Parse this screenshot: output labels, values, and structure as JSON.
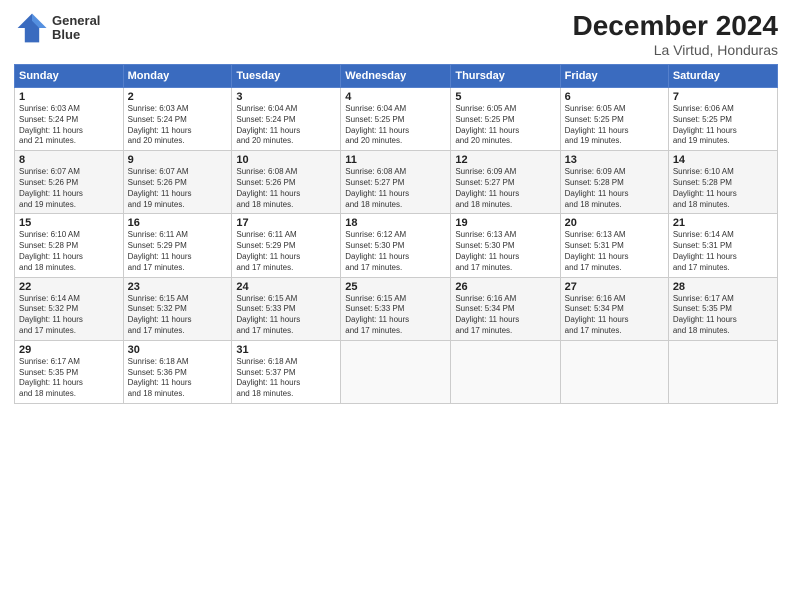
{
  "header": {
    "logo_line1": "General",
    "logo_line2": "Blue",
    "title": "December 2024",
    "subtitle": "La Virtud, Honduras"
  },
  "weekdays": [
    "Sunday",
    "Monday",
    "Tuesday",
    "Wednesday",
    "Thursday",
    "Friday",
    "Saturday"
  ],
  "weeks": [
    [
      {
        "day": "1",
        "info": "Sunrise: 6:03 AM\nSunset: 5:24 PM\nDaylight: 11 hours\nand 21 minutes."
      },
      {
        "day": "2",
        "info": "Sunrise: 6:03 AM\nSunset: 5:24 PM\nDaylight: 11 hours\nand 20 minutes."
      },
      {
        "day": "3",
        "info": "Sunrise: 6:04 AM\nSunset: 5:24 PM\nDaylight: 11 hours\nand 20 minutes."
      },
      {
        "day": "4",
        "info": "Sunrise: 6:04 AM\nSunset: 5:25 PM\nDaylight: 11 hours\nand 20 minutes."
      },
      {
        "day": "5",
        "info": "Sunrise: 6:05 AM\nSunset: 5:25 PM\nDaylight: 11 hours\nand 20 minutes."
      },
      {
        "day": "6",
        "info": "Sunrise: 6:05 AM\nSunset: 5:25 PM\nDaylight: 11 hours\nand 19 minutes."
      },
      {
        "day": "7",
        "info": "Sunrise: 6:06 AM\nSunset: 5:25 PM\nDaylight: 11 hours\nand 19 minutes."
      }
    ],
    [
      {
        "day": "8",
        "info": "Sunrise: 6:07 AM\nSunset: 5:26 PM\nDaylight: 11 hours\nand 19 minutes."
      },
      {
        "day": "9",
        "info": "Sunrise: 6:07 AM\nSunset: 5:26 PM\nDaylight: 11 hours\nand 19 minutes."
      },
      {
        "day": "10",
        "info": "Sunrise: 6:08 AM\nSunset: 5:26 PM\nDaylight: 11 hours\nand 18 minutes."
      },
      {
        "day": "11",
        "info": "Sunrise: 6:08 AM\nSunset: 5:27 PM\nDaylight: 11 hours\nand 18 minutes."
      },
      {
        "day": "12",
        "info": "Sunrise: 6:09 AM\nSunset: 5:27 PM\nDaylight: 11 hours\nand 18 minutes."
      },
      {
        "day": "13",
        "info": "Sunrise: 6:09 AM\nSunset: 5:28 PM\nDaylight: 11 hours\nand 18 minutes."
      },
      {
        "day": "14",
        "info": "Sunrise: 6:10 AM\nSunset: 5:28 PM\nDaylight: 11 hours\nand 18 minutes."
      }
    ],
    [
      {
        "day": "15",
        "info": "Sunrise: 6:10 AM\nSunset: 5:28 PM\nDaylight: 11 hours\nand 18 minutes."
      },
      {
        "day": "16",
        "info": "Sunrise: 6:11 AM\nSunset: 5:29 PM\nDaylight: 11 hours\nand 17 minutes."
      },
      {
        "day": "17",
        "info": "Sunrise: 6:11 AM\nSunset: 5:29 PM\nDaylight: 11 hours\nand 17 minutes."
      },
      {
        "day": "18",
        "info": "Sunrise: 6:12 AM\nSunset: 5:30 PM\nDaylight: 11 hours\nand 17 minutes."
      },
      {
        "day": "19",
        "info": "Sunrise: 6:13 AM\nSunset: 5:30 PM\nDaylight: 11 hours\nand 17 minutes."
      },
      {
        "day": "20",
        "info": "Sunrise: 6:13 AM\nSunset: 5:31 PM\nDaylight: 11 hours\nand 17 minutes."
      },
      {
        "day": "21",
        "info": "Sunrise: 6:14 AM\nSunset: 5:31 PM\nDaylight: 11 hours\nand 17 minutes."
      }
    ],
    [
      {
        "day": "22",
        "info": "Sunrise: 6:14 AM\nSunset: 5:32 PM\nDaylight: 11 hours\nand 17 minutes."
      },
      {
        "day": "23",
        "info": "Sunrise: 6:15 AM\nSunset: 5:32 PM\nDaylight: 11 hours\nand 17 minutes."
      },
      {
        "day": "24",
        "info": "Sunrise: 6:15 AM\nSunset: 5:33 PM\nDaylight: 11 hours\nand 17 minutes."
      },
      {
        "day": "25",
        "info": "Sunrise: 6:15 AM\nSunset: 5:33 PM\nDaylight: 11 hours\nand 17 minutes."
      },
      {
        "day": "26",
        "info": "Sunrise: 6:16 AM\nSunset: 5:34 PM\nDaylight: 11 hours\nand 17 minutes."
      },
      {
        "day": "27",
        "info": "Sunrise: 6:16 AM\nSunset: 5:34 PM\nDaylight: 11 hours\nand 17 minutes."
      },
      {
        "day": "28",
        "info": "Sunrise: 6:17 AM\nSunset: 5:35 PM\nDaylight: 11 hours\nand 18 minutes."
      }
    ],
    [
      {
        "day": "29",
        "info": "Sunrise: 6:17 AM\nSunset: 5:35 PM\nDaylight: 11 hours\nand 18 minutes."
      },
      {
        "day": "30",
        "info": "Sunrise: 6:18 AM\nSunset: 5:36 PM\nDaylight: 11 hours\nand 18 minutes."
      },
      {
        "day": "31",
        "info": "Sunrise: 6:18 AM\nSunset: 5:37 PM\nDaylight: 11 hours\nand 18 minutes."
      },
      null,
      null,
      null,
      null
    ]
  ]
}
